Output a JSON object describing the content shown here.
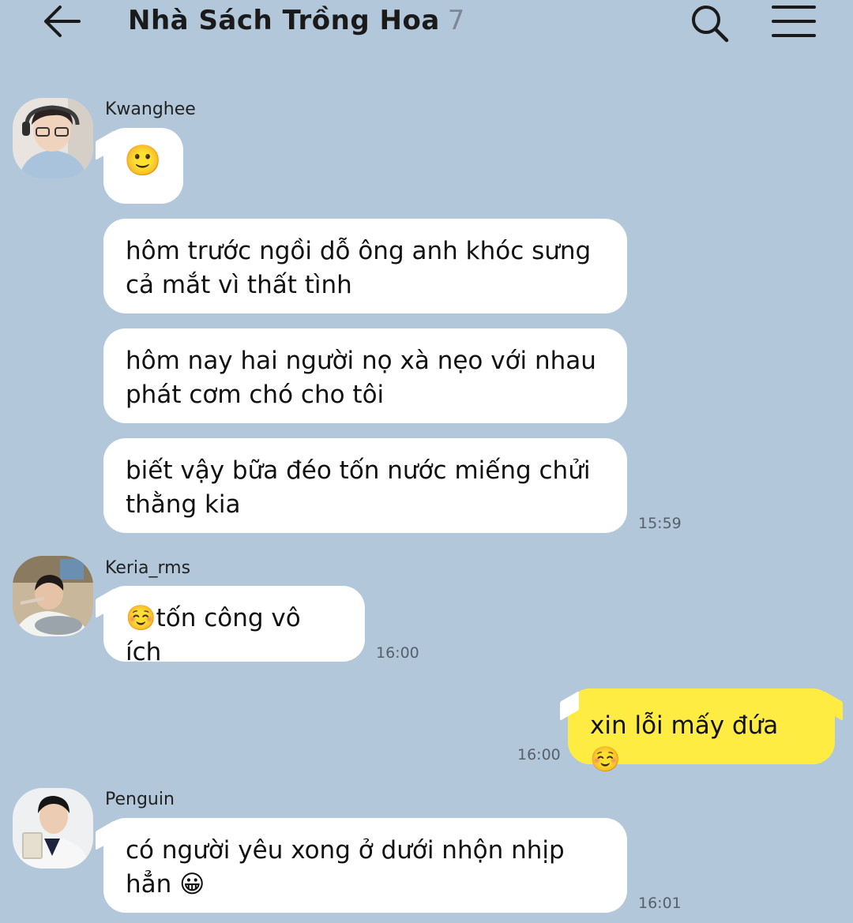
{
  "header": {
    "back_icon": "arrow-left-icon",
    "title": "Nhà Sách Trồng Hoa",
    "member_count": "7",
    "search_icon": "search-icon",
    "menu_icon": "hamburger-menu-icon"
  },
  "colors": {
    "background": "#b2c7da",
    "bubble_incoming": "#ffffff",
    "bubble_outgoing": "#ffec42"
  },
  "messages": [
    {
      "sender": "Kwanghee",
      "bubbles": [
        "🙂",
        "hôm trước ngồi dỗ ông anh khóc sưng cả mắt vì thất tình",
        "hôm nay hai người nọ xà nẹo với nhau phát cơm chó cho tôi",
        "biết vậy bữa đéo tốn nước miếng chửi thằng kia"
      ],
      "time": "15:59"
    },
    {
      "sender": "Keria_rms",
      "bubbles": [
        "☺️tốn công vô ích"
      ],
      "time": "16:00"
    },
    {
      "sender": "me",
      "bubbles": [
        "xin lỗi mấy đứa ☺️"
      ],
      "time": "16:00"
    },
    {
      "sender": "Penguin",
      "bubbles": [
        "có người yêu xong ở dưới nhộn nhịp hẳn 😀"
      ],
      "time": "16:01"
    }
  ]
}
